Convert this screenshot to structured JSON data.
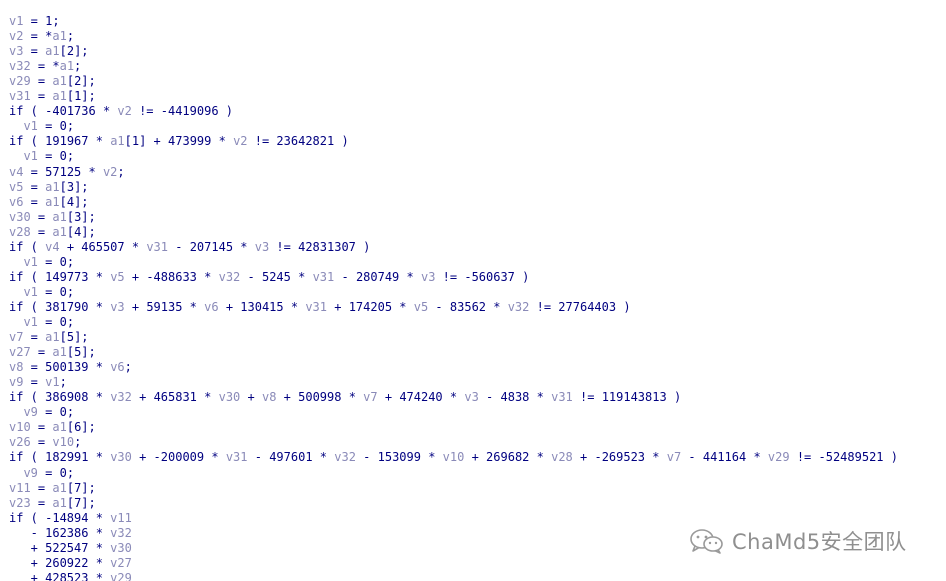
{
  "code": {
    "lines": [
      "v1 = 1;",
      "v2 = *a1;",
      "v3 = a1[2];",
      "v32 = *a1;",
      "v29 = a1[2];",
      "v31 = a1[1];",
      "if ( -401736 * v2 != -4419096 )",
      "  v1 = 0;",
      "if ( 191967 * a1[1] + 473999 * v2 != 23642821 )",
      "  v1 = 0;",
      "v4 = 57125 * v2;",
      "v5 = a1[3];",
      "v6 = a1[4];",
      "v30 = a1[3];",
      "v28 = a1[4];",
      "if ( v4 + 465507 * v31 - 207145 * v3 != 42831307 )",
      "  v1 = 0;",
      "if ( 149773 * v5 + -488633 * v32 - 5245 * v31 - 280749 * v3 != -560637 )",
      "  v1 = 0;",
      "if ( 381790 * v3 + 59135 * v6 + 130415 * v31 + 174205 * v5 - 83562 * v32 != 27764403 )",
      "  v1 = 0;",
      "v7 = a1[5];",
      "v27 = a1[5];",
      "v8 = 500139 * v6;",
      "v9 = v1;",
      "if ( 386908 * v32 + 465831 * v30 + v8 + 500998 * v7 + 474240 * v3 - 4838 * v31 != 119143813 )",
      "  v9 = 0;",
      "v10 = a1[6];",
      "v26 = v10;",
      "if ( 182991 * v30 + -200009 * v31 - 497601 * v32 - 153099 * v10 + 269682 * v28 + -269523 * v7 - 441164 * v29 != -52489521 )",
      "  v9 = 0;",
      "v11 = a1[7];",
      "v23 = a1[7];",
      "if ( -14894 * v11",
      "   - 162386 * v32",
      "   + 522547 * v30",
      "   + 260922 * v27",
      "   + 428523 * v29"
    ]
  },
  "watermark": {
    "text": "ChaMd5安全团队",
    "icon": "wechat-icon",
    "color": "#8f8f8f"
  },
  "colors": {
    "code_text": "#000080",
    "variable": "#8a8ab8",
    "background": "#ffffff"
  }
}
